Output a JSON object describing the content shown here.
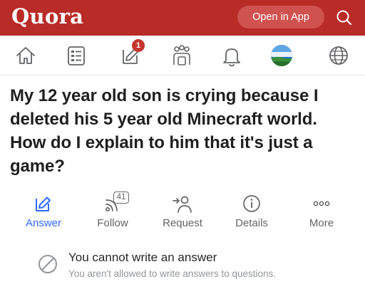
{
  "header": {
    "logo": "Quora",
    "open_app_label": "Open in App",
    "brand_color": "#b92b27",
    "search_icon": "search-icon"
  },
  "nav": {
    "icons": [
      "home-icon",
      "following-feed-icon",
      "write-edit-icon",
      "spaces-icon",
      "notifications-bell-icon",
      "avatar",
      "language-globe-icon"
    ],
    "answer_badge_count": "1"
  },
  "question": {
    "title": "My 12 year old son is crying because I deleted his 5 year old Minecraft world. How do I explain to him that it's just a game?"
  },
  "actions": {
    "answer_label": "Answer",
    "follow_label": "Follow",
    "follow_count": "41",
    "request_label": "Request",
    "details_label": "Details",
    "more_label": "More",
    "accent_color": "#2e69ff"
  },
  "notice": {
    "title": "You cannot write an answer",
    "subtitle": "You aren't allowed to write answers to questions."
  }
}
